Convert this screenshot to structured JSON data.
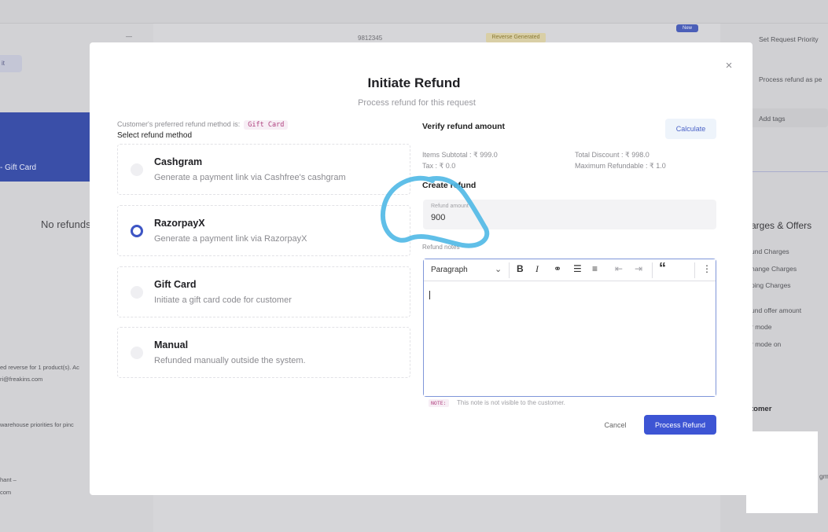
{
  "background": {
    "left_chip": "it",
    "blue_card_label": "- Gift Card",
    "no_refunds": "No refunds",
    "note_line_1": "ed reverse for 1 product(s). Ac",
    "note_line_2": "ri@freakins.com",
    "note_line_3": "warehouse priorities for pinc",
    "note_line_4": "hant –",
    "note_line_5": "com",
    "row_phone": "9812345",
    "row_dash": "—",
    "row_badge": "Reverse Generated",
    "new_badge": "New",
    "right_items": {
      "set_priority": "Set Request Priority",
      "process_refund_as": "Process refund as pe",
      "add_tags": "Add tags",
      "charges_heading": "arges & Offers",
      "und_charges": "und Charges",
      "hange_charges": "hange Charges",
      "ping_charges": "ping Charges",
      "offer_amount": "und offer amount",
      "mode": "r mode",
      "mode_on": "r mode on",
      "customer_heading": "tomer",
      "email_frag": "gm"
    }
  },
  "modal": {
    "title": "Initiate Refund",
    "subtitle": "Process refund for this request",
    "close_glyph": "×",
    "preferred_text": "Customer's preferred refund method is:",
    "preferred_value": "Gift Card",
    "select_label": "Select refund method",
    "methods": [
      {
        "title": "Cashgram",
        "desc": "Generate a payment link via Cashfree's cashgram",
        "selected": false
      },
      {
        "title": "RazorpayX",
        "desc": "Generate a payment link via RazorpayX",
        "selected": true
      },
      {
        "title": "Gift Card",
        "desc": "Initiate a gift card code for customer",
        "selected": false
      },
      {
        "title": "Manual",
        "desc": "Refunded manually outside the system.",
        "selected": false
      }
    ],
    "verify_label": "Verify refund amount",
    "calculate_label": "Calculate",
    "items_subtotal": "Items Subtotal : ₹ 999.0",
    "tax": "Tax : ₹ 0.0",
    "total_discount": "Total Discount : ₹ 998.0",
    "max_refundable": "Maximum Refundable : ₹ 1.0",
    "create_label": "Create refund",
    "refund_amount_label": "Refund amount",
    "refund_amount_value": "900",
    "refund_notes_label": "Refund notes",
    "editor": {
      "paragraph": "Paragraph",
      "chevron": "⌄",
      "bold": "B",
      "italic": "I",
      "link": "⚭",
      "bullets": "☰",
      "numbered": "≡",
      "outdent": "⇤",
      "indent": "⇥",
      "quote": "“",
      "more": "⋮"
    },
    "note_chip": "NOTE:",
    "note_text": "This note is not visible to the customer.",
    "cancel_label": "Cancel",
    "process_label": "Process Refund"
  },
  "colors": {
    "accent": "#3d55d4",
    "scribble": "#4fb8e6"
  }
}
